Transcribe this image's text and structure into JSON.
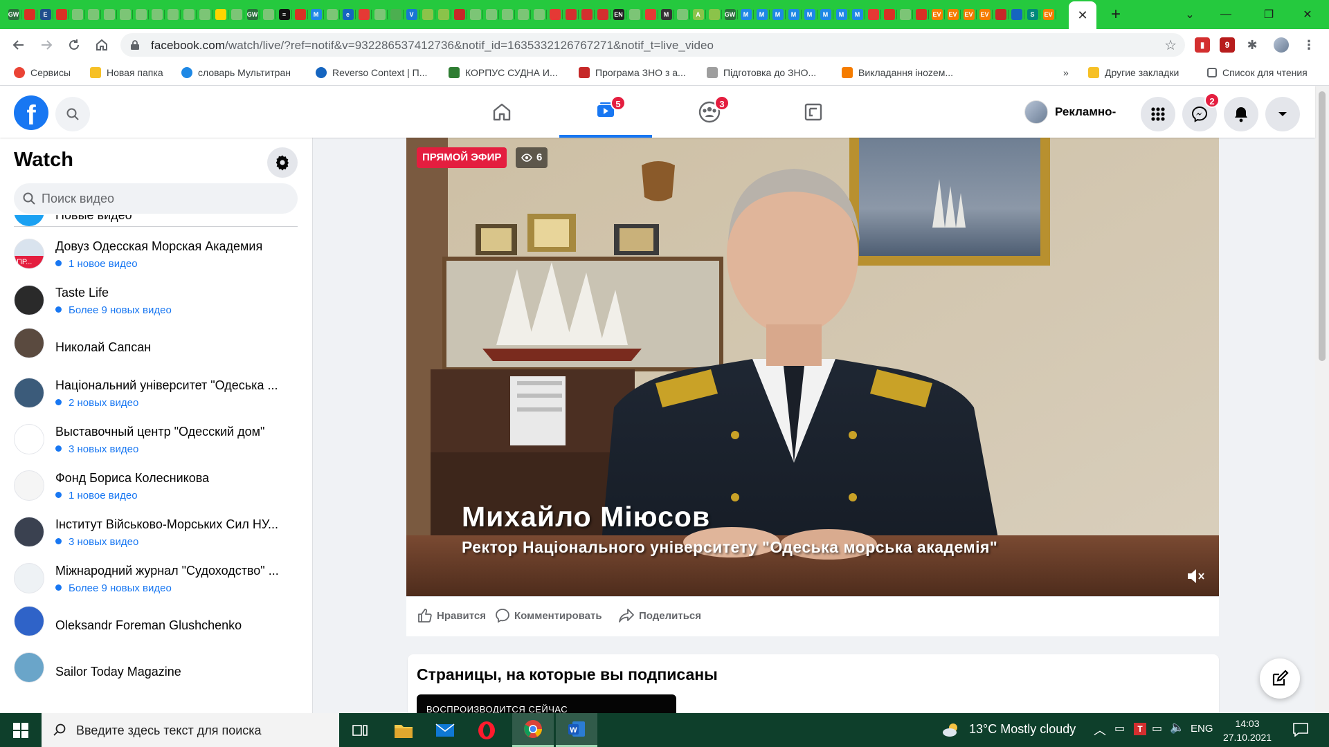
{
  "browser": {
    "tab_strip_color": "#25c93e",
    "mini_tabs": [
      {
        "icon": "gw-icon",
        "color": "#2b6e3b",
        "text": "GW"
      },
      {
        "icon": "red-circle-icon",
        "color": "#d93025",
        "text": ""
      },
      {
        "icon": "e-icon",
        "color": "#1f4e8c",
        "text": "E"
      },
      {
        "icon": "red-circle-icon",
        "color": "#d93025",
        "text": ""
      },
      {
        "icon": "doc-icon",
        "color": "#7cc576",
        "text": ""
      },
      {
        "icon": "doc-icon",
        "color": "#7cc576",
        "text": ""
      },
      {
        "icon": "doc-icon",
        "color": "#7cc576",
        "text": ""
      },
      {
        "icon": "doc-icon",
        "color": "#7cc576",
        "text": ""
      },
      {
        "icon": "doc-icon",
        "color": "#7cc576",
        "text": ""
      },
      {
        "icon": "doc-icon",
        "color": "#7cc576",
        "text": ""
      },
      {
        "icon": "doc-icon",
        "color": "#7cc576",
        "text": ""
      },
      {
        "icon": "doc-icon",
        "color": "#7cc576",
        "text": ""
      },
      {
        "icon": "doc-icon",
        "color": "#7cc576",
        "text": ""
      },
      {
        "icon": "ua-flag-icon",
        "color": "#ffd500",
        "text": ""
      },
      {
        "icon": "doc-icon",
        "color": "#7cc576",
        "text": ""
      },
      {
        "icon": "gw-icon",
        "color": "#2b6e3b",
        "text": "GW"
      },
      {
        "icon": "doc-icon",
        "color": "#7cc576",
        "text": ""
      },
      {
        "icon": "list-icon",
        "color": "#111111",
        "text": "≡"
      },
      {
        "icon": "book-icon",
        "color": "#d93025",
        "text": ""
      },
      {
        "icon": "m-icon",
        "color": "#1e88e5",
        "text": "M"
      },
      {
        "icon": "doc-icon",
        "color": "#7cc576",
        "text": ""
      },
      {
        "icon": "e-icon",
        "color": "#1565c0",
        "text": "e"
      },
      {
        "icon": "red-square-icon",
        "color": "#e53935",
        "text": ""
      },
      {
        "icon": "doc-icon",
        "color": "#7cc576",
        "text": ""
      },
      {
        "icon": "shield-icon",
        "color": "#4caf50",
        "text": ""
      },
      {
        "icon": "v-icon",
        "color": "#1976d2",
        "text": "V"
      },
      {
        "icon": "leaf-icon",
        "color": "#8bc34a",
        "text": ""
      },
      {
        "icon": "leaf-icon",
        "color": "#8bc34a",
        "text": ""
      },
      {
        "icon": "uk-flag-icon",
        "color": "#c62828",
        "text": ""
      },
      {
        "icon": "doc-icon",
        "color": "#7cc576",
        "text": ""
      },
      {
        "icon": "doc-icon",
        "color": "#7cc576",
        "text": ""
      },
      {
        "icon": "doc-icon",
        "color": "#7cc576",
        "text": ""
      },
      {
        "icon": "doc-icon",
        "color": "#7cc576",
        "text": ""
      },
      {
        "icon": "doc-icon",
        "color": "#7cc576",
        "text": ""
      },
      {
        "icon": "flag-icon",
        "color": "#e53935",
        "text": ""
      },
      {
        "icon": "shield-icon",
        "color": "#d32f2f",
        "text": ""
      },
      {
        "icon": "shield-icon",
        "color": "#d32f2f",
        "text": ""
      },
      {
        "icon": "shield-icon",
        "color": "#d32f2f",
        "text": ""
      },
      {
        "icon": "en-icon",
        "color": "#222222",
        "text": "EN"
      },
      {
        "icon": "doc-icon",
        "color": "#7cc576",
        "text": ""
      },
      {
        "icon": "flag-icon",
        "color": "#e53935",
        "text": ""
      },
      {
        "icon": "m-icon",
        "color": "#333333",
        "text": "M"
      },
      {
        "icon": "doc-icon",
        "color": "#7cc576",
        "text": ""
      },
      {
        "icon": "a-icon",
        "color": "#8bc34a",
        "text": "A"
      },
      {
        "icon": "leaf-icon",
        "color": "#8bc34a",
        "text": ""
      },
      {
        "icon": "gw-icon",
        "color": "#2b6e3b",
        "text": "GW"
      },
      {
        "icon": "m-icon",
        "color": "#1e88e5",
        "text": "M"
      },
      {
        "icon": "m-icon",
        "color": "#1e88e5",
        "text": "M"
      },
      {
        "icon": "m-icon",
        "color": "#1e88e5",
        "text": "M"
      },
      {
        "icon": "m-icon",
        "color": "#1e88e5",
        "text": "M"
      },
      {
        "icon": "m-icon",
        "color": "#1e88e5",
        "text": "M"
      },
      {
        "icon": "m-icon",
        "color": "#1e88e5",
        "text": "M"
      },
      {
        "icon": "m-icon",
        "color": "#1e88e5",
        "text": "M"
      },
      {
        "icon": "m-icon",
        "color": "#1e88e5",
        "text": "M"
      },
      {
        "icon": "flag-icon",
        "color": "#e53935",
        "text": ""
      },
      {
        "icon": "red-circle-icon",
        "color": "#d93025",
        "text": ""
      },
      {
        "icon": "doc-icon",
        "color": "#7cc576",
        "text": ""
      },
      {
        "icon": "red-circle-icon",
        "color": "#d93025",
        "text": ""
      },
      {
        "icon": "ev-icon",
        "color": "#f57c00",
        "text": "EV"
      },
      {
        "icon": "ev-icon",
        "color": "#f57c00",
        "text": "EV"
      },
      {
        "icon": "ev-icon",
        "color": "#f57c00",
        "text": "EV"
      },
      {
        "icon": "ev-icon",
        "color": "#f57c00",
        "text": "EV"
      },
      {
        "icon": "flag-icon",
        "color": "#c62828",
        "text": ""
      },
      {
        "icon": "uk-flag-icon",
        "color": "#1565c0",
        "text": ""
      },
      {
        "icon": "s-icon",
        "color": "#00897b",
        "text": "S"
      },
      {
        "icon": "ev-icon",
        "color": "#f57c00",
        "text": "EV"
      }
    ],
    "active_tab_close": "✕",
    "new_tab": "+",
    "window_controls": {
      "minimize": "—",
      "restore": "❐",
      "close": "✕",
      "tabsearch": "⌄"
    },
    "url": {
      "host": "facebook.com",
      "path": "/watch/live/?ref=notif&v=932286537412736&notif_id=1635332126767271&notif_t=live_video"
    },
    "bookmarks": [
      {
        "label": "Сервисы",
        "icon": "apps-grid-icon",
        "color": "#ea4335"
      },
      {
        "label": "Новая папка",
        "icon": "folder-icon",
        "color": "#f6c026"
      },
      {
        "label": "словарь Мультитран",
        "icon": "multitran-icon",
        "color": "#1e88e5"
      },
      {
        "label": "Reverso Context | П...",
        "icon": "reverso-icon",
        "color": "#1565c0"
      },
      {
        "label": "КОРПУС СУДНА И...",
        "icon": "tree-icon",
        "color": "#2e7d32"
      },
      {
        "label": "Програма ЗНО з а...",
        "icon": "envelope-icon",
        "color": "#c62828"
      },
      {
        "label": "Підготовка до ЗНО...",
        "icon": "book-icon",
        "color": "#9e9e9e"
      },
      {
        "label": "Викладання іноzем...",
        "icon": "blogger-icon",
        "color": "#f57c00"
      }
    ],
    "bookmarks_more": "»",
    "other_bookmarks": "Другие закладки",
    "reading_list": "Список для чтения"
  },
  "facebook": {
    "logo": "f",
    "nav_badges": {
      "watch": "5",
      "groups": "3"
    },
    "profile_name": "Рекламно-",
    "messenger_badge": "2",
    "sidebar": {
      "title": "Watch",
      "search_placeholder": "Поиск видео",
      "partial_item": "Новые видео",
      "items": [
        {
          "name": "Довуз Одесская Морская Академия",
          "sub": "1 новое видео",
          "badge": "ПР...",
          "avatar_color": "#d9e3ee"
        },
        {
          "name": "Taste Life",
          "sub": "Более 9 новых видео",
          "avatar_color": "#2a2a2a"
        },
        {
          "name": "Николай Сапсан",
          "sub": "",
          "avatar_color": "#5a4a3f"
        },
        {
          "name": "Національний університет \"Одеська ...",
          "sub": "2 новых видео",
          "avatar_color": "#3b5b7a"
        },
        {
          "name": "Выставочный центр \"Одесский дом\"",
          "sub": "3 новых видео",
          "avatar_color": "#ffffff"
        },
        {
          "name": "Фонд Бориса Колесникова",
          "sub": "1 новое видео",
          "avatar_color": "#f5f5f5"
        },
        {
          "name": "Інститут Військово-Морських Сил НУ...",
          "sub": "3 новых видео",
          "avatar_color": "#3a4150"
        },
        {
          "name": "Міжнародний журнал \"Судоходство\" ...",
          "sub": "Более 9 новых видео",
          "avatar_color": "#eef2f5"
        },
        {
          "name": "Oleksandr Foreman Glushchenko",
          "sub": "",
          "avatar_color": "#2f63c8"
        },
        {
          "name": "Sailor Today Magazine",
          "sub": "",
          "avatar_color": "#6aa5c9"
        }
      ]
    },
    "video": {
      "live_label": "ПРЯМОЙ ЭФИР",
      "viewers": "6",
      "caption_name": "Михайло Міюсов",
      "caption_title": "Ректор Національного університету \"Одеська морська академія\""
    },
    "actions": {
      "like": "Нравится",
      "comment": "Комментировать",
      "share": "Поделиться"
    },
    "pages_card": {
      "title": "Страницы, на которые вы подписаны",
      "now_playing": "ВОСПРОИЗВОДИТСЯ СЕЙЧАС"
    }
  },
  "taskbar": {
    "search_placeholder": "Введите здесь текст для поиска",
    "weather": "13°C  Mostly cloudy",
    "language": "ENG",
    "time": "14:03",
    "date": "27.10.2021",
    "apps": [
      "task-view-icon",
      "file-explorer-icon",
      "mail-icon",
      "opera-icon",
      "chrome-icon",
      "word-icon"
    ]
  }
}
